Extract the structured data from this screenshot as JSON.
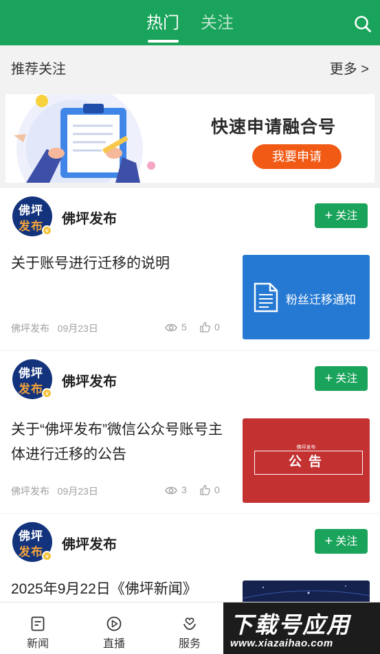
{
  "header": {
    "tabs": [
      {
        "label": "热门",
        "active": true
      },
      {
        "label": "关注",
        "active": false
      }
    ],
    "search_icon": "search-icon",
    "accent_color": "#1aa35a"
  },
  "recommend": {
    "title": "推荐关注",
    "more_label": "更多 >"
  },
  "banner": {
    "title": "快速申请融合号",
    "button_label": "我要申请"
  },
  "feed": [
    {
      "avatar_line1": "佛坪",
      "avatar_line2": "发布",
      "author": "佛坪发布",
      "follow_label": "关注",
      "title": "关于账号进行迁移的说明",
      "source": "佛坪发布",
      "date": "09月23日",
      "views": "5",
      "likes": "0",
      "thumb_text": "粉丝迁移通知"
    },
    {
      "avatar_line1": "佛坪",
      "avatar_line2": "发布",
      "author": "佛坪发布",
      "follow_label": "关注",
      "title": "关于“佛坪发布”微信公众号账号主体进行迁移的公告",
      "source": "佛坪发布",
      "date": "09月23日",
      "views": "3",
      "likes": "0",
      "thumb_small": "佛坪发布",
      "thumb_text": "公告"
    },
    {
      "avatar_line1": "佛坪",
      "avatar_line2": "发布",
      "author": "佛坪发布",
      "follow_label": "关注",
      "title": "2025年9月22日《佛坪新闻》"
    }
  ],
  "bottom_nav": [
    {
      "label": "新闻",
      "icon": "news-icon"
    },
    {
      "label": "直播",
      "icon": "play-icon"
    },
    {
      "label": "服务",
      "icon": "service-icon"
    }
  ],
  "watermark": {
    "main": "下载号应用",
    "url": "www.xiazaihao.com"
  }
}
